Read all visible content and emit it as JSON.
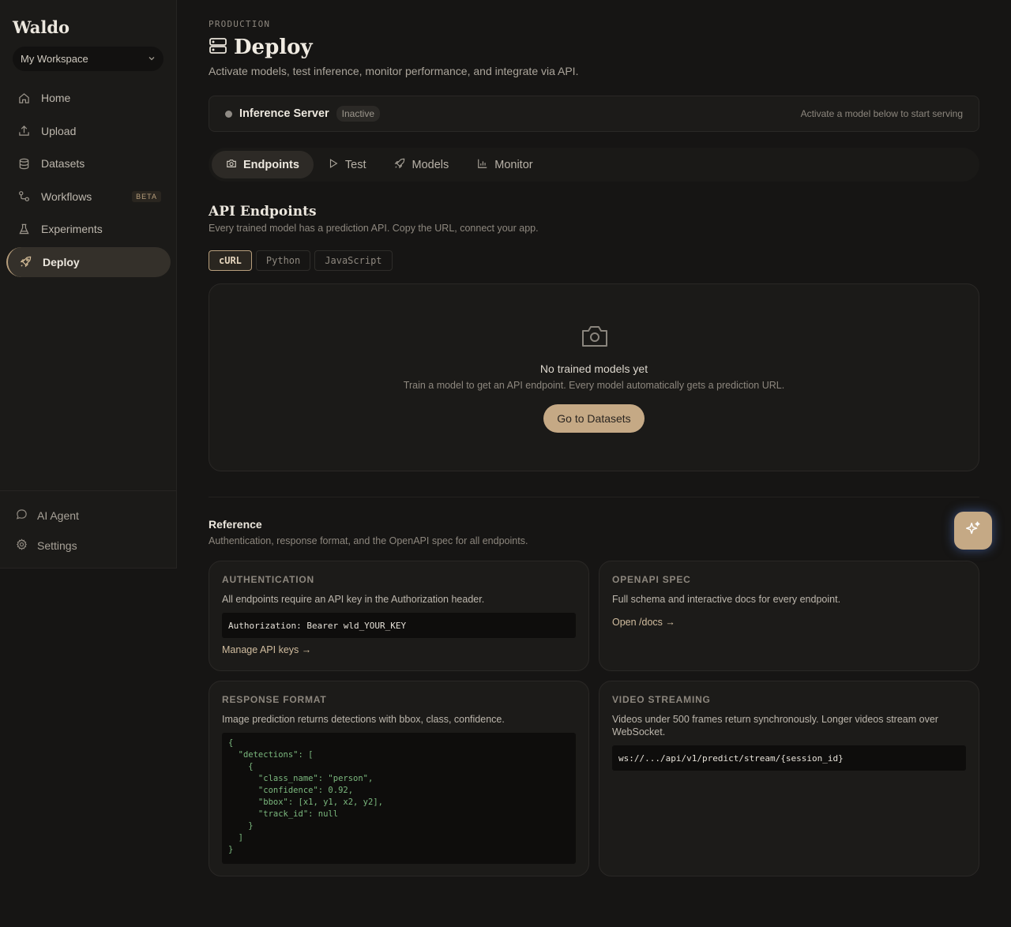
{
  "sidebar": {
    "brand": "Waldo",
    "workspace": "My Workspace",
    "items": [
      {
        "label": "Home",
        "icon": "home-icon"
      },
      {
        "label": "Upload",
        "icon": "upload-icon"
      },
      {
        "label": "Datasets",
        "icon": "database-icon"
      },
      {
        "label": "Workflows",
        "icon": "workflow-icon",
        "badge": "BETA"
      },
      {
        "label": "Experiments",
        "icon": "flask-icon"
      },
      {
        "label": "Deploy",
        "icon": "rocket-icon",
        "active": true
      }
    ],
    "footer": [
      {
        "label": "AI Agent",
        "icon": "chat-icon"
      },
      {
        "label": "Settings",
        "icon": "gear-icon"
      }
    ]
  },
  "header": {
    "eyebrow": "PRODUCTION",
    "title": "Deploy",
    "subtitle": "Activate models, test inference, monitor performance, and integrate via API."
  },
  "server": {
    "name": "Inference Server",
    "status": "Inactive",
    "hint": "Activate a model below to start serving"
  },
  "tabs": [
    {
      "label": "Endpoints",
      "icon": "camera-icon",
      "active": true
    },
    {
      "label": "Test",
      "icon": "play-icon"
    },
    {
      "label": "Models",
      "icon": "rocket-icon"
    },
    {
      "label": "Monitor",
      "icon": "bar-chart-icon"
    }
  ],
  "endpoints": {
    "title": "API Endpoints",
    "subtitle": "Every trained model has a prediction API. Copy the URL, connect your app.",
    "languages": [
      "cURL",
      "Python",
      "JavaScript"
    ],
    "selected_language": "cURL",
    "empty_title": "No trained models yet",
    "empty_subtitle": "Train a model to get an API endpoint. Every model automatically gets a prediction URL.",
    "cta": "Go to Datasets"
  },
  "reference": {
    "title": "Reference",
    "subtitle": "Authentication, response format, and the OpenAPI spec for all endpoints.",
    "auth": {
      "label": "AUTHENTICATION",
      "text": "All endpoints require an API key in the Authorization header.",
      "code": "Authorization: Bearer wld_YOUR_KEY",
      "link": "Manage API keys →"
    },
    "openapi": {
      "label": "OPENAPI SPEC",
      "text": "Full schema and interactive docs for every endpoint.",
      "link": "Open /docs →"
    },
    "response": {
      "label": "RESPONSE FORMAT",
      "text": "Image prediction returns detections with bbox, class, confidence.",
      "code": "{\n  \"detections\": [\n    {\n      \"class_name\": \"person\",\n      \"confidence\": 0.92,\n      \"bbox\": [x1, y1, x2, y2],\n      \"track_id\": null\n    }\n  ]\n}"
    },
    "video": {
      "label": "VIDEO STREAMING",
      "text": "Videos under 500 frames return synchronously. Longer videos stream over WebSocket.",
      "code": "ws://.../api/v1/predict/stream/{session_id}"
    }
  },
  "fab": {
    "icon": "sparkle-icon"
  }
}
